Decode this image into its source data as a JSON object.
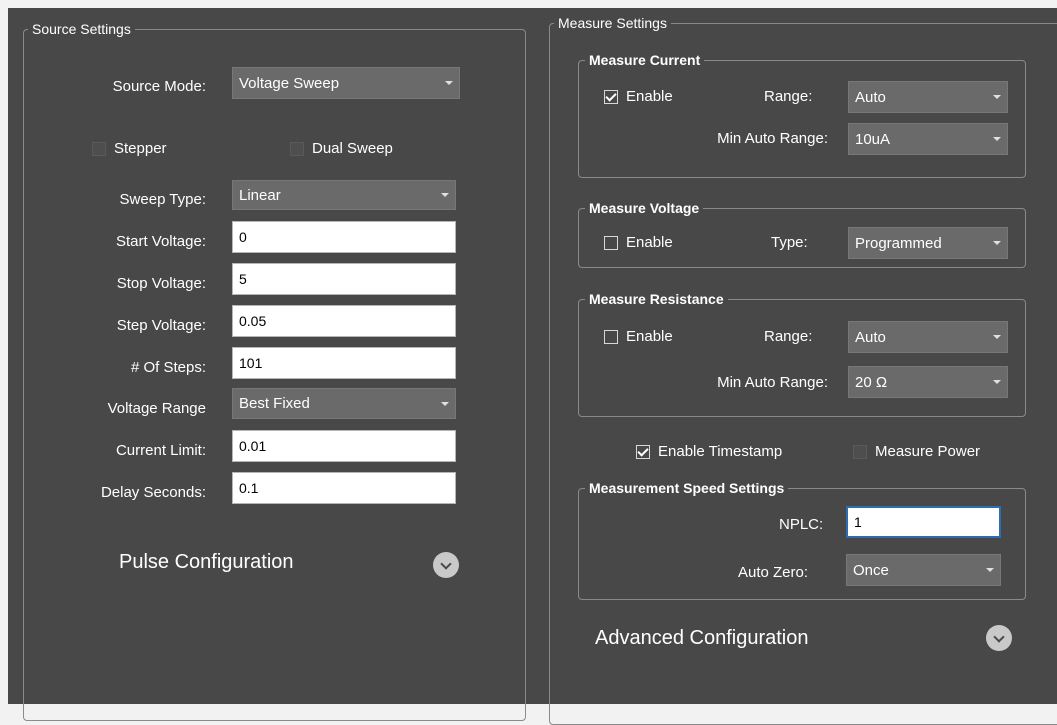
{
  "source": {
    "title": "Source Settings",
    "source_mode_label": "Source Mode:",
    "source_mode_value": "Voltage Sweep",
    "stepper_label": "Stepper",
    "dual_sweep_label": "Dual Sweep",
    "sweep_type_label": "Sweep Type:",
    "sweep_type_value": "Linear",
    "start_voltage_label": "Start Voltage:",
    "start_voltage_value": "0",
    "stop_voltage_label": "Stop Voltage:",
    "stop_voltage_value": "5",
    "step_voltage_label": "Step Voltage:",
    "step_voltage_value": "0.05",
    "num_steps_label": "# Of Steps:",
    "num_steps_value": "101",
    "voltage_range_label": "Voltage Range",
    "voltage_range_value": "Best Fixed",
    "current_limit_label": "Current Limit:",
    "current_limit_value": "0.01",
    "delay_seconds_label": "Delay Seconds:",
    "delay_seconds_value": "0.1",
    "pulse_config_label": "Pulse Configuration"
  },
  "measure": {
    "title": "Measure Settings",
    "current": {
      "title": "Measure Current",
      "enable_label": "Enable",
      "enabled": true,
      "range_label": "Range:",
      "range_value": "Auto",
      "min_auto_range_label": "Min Auto Range:",
      "min_auto_range_value": "10uA"
    },
    "voltage": {
      "title": "Measure Voltage",
      "enable_label": "Enable",
      "enabled": false,
      "type_label": "Type:",
      "type_value": "Programmed"
    },
    "resistance": {
      "title": "Measure Resistance",
      "enable_label": "Enable",
      "enabled": false,
      "range_label": "Range:",
      "range_value": "Auto",
      "min_auto_range_label": "Min Auto Range:",
      "min_auto_range_value": "20 Ω"
    },
    "enable_timestamp_label": "Enable Timestamp",
    "enable_timestamp_checked": true,
    "measure_power_label": "Measure Power",
    "speed": {
      "title": "Measurement Speed Settings",
      "nplc_label": "NPLC:",
      "nplc_value": "1",
      "auto_zero_label": "Auto Zero:",
      "auto_zero_value": "Once"
    },
    "advanced_config_label": "Advanced Configuration"
  }
}
